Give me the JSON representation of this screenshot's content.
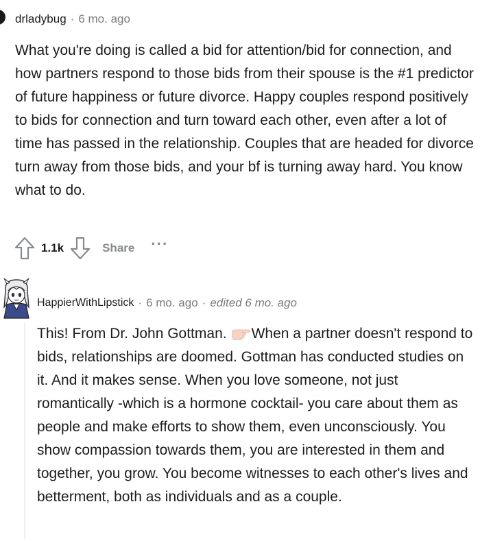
{
  "comment1": {
    "username": "drladybug",
    "separator": "·",
    "time": "6 mo. ago",
    "body": "What you're doing is called a bid for attention/bid for connection, and how partners respond to those bids from their spouse is the #1 predictor of future happiness or future divorce. Happy couples respond positively to bids for connection and turn toward each other, even after a lot of time has passed in the relationship. Couples that are headed for divorce turn away from those bids, and your bf is turning away hard. You know what to do.",
    "votes": "1.1k",
    "share_label": "Share",
    "more_label": "···"
  },
  "comment2": {
    "username": "HappierWithLipstick",
    "separator": "·",
    "time": "6 mo. ago",
    "separator2": "·",
    "edited": "edited 6 mo. ago",
    "body_before_emoji": "This! From Dr. John Gottman.",
    "body_after_emoji": "When a partner doesn't respond to bids, relationships are doomed. Gottman has conducted studies on it. And it makes sense. When you love someone, not just romantically -which is a hormone cocktail- you care about them as people and make efforts to show them, even unconsciously. You show compassion towards them, you are interested in them and together, you grow. You become witnesses to each other's lives and betterment, both as individuals and as a couple."
  },
  "colors": {
    "text": "#1c1c1c",
    "meta": "#7c7c7c",
    "action_gray": "#878a8c",
    "thread_line": "#edeff1"
  },
  "icons": [
    "upvote-icon",
    "downvote-icon",
    "pointing-hand-emoji",
    "avatar"
  ]
}
